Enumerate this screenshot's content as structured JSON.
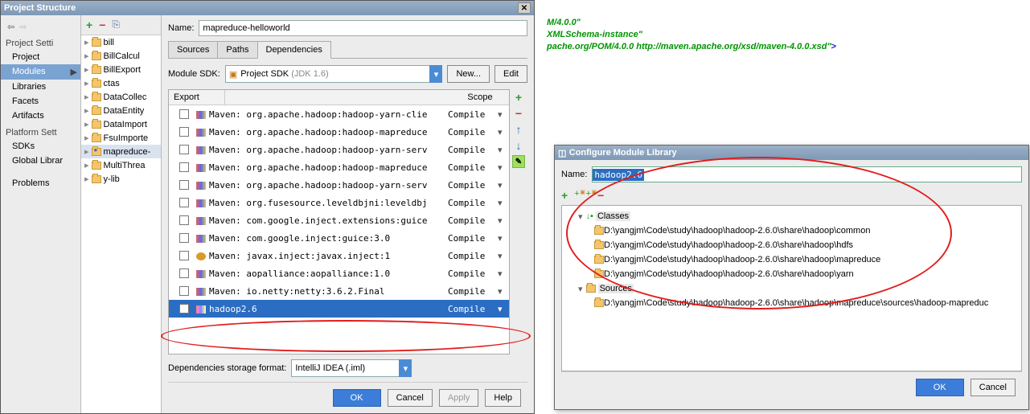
{
  "ps": {
    "title": "Project Structure",
    "sidebar": {
      "section1": "Project Setti",
      "items1": [
        "Project",
        "Modules",
        "Libraries",
        "Facets",
        "Artifacts"
      ],
      "section2": "Platform Sett",
      "items2": [
        "SDKs",
        "Global Librar"
      ],
      "section3": "Problems"
    },
    "modules": [
      "bill",
      "BillCalcul",
      "BillExport",
      "ctas",
      "DataCollec",
      "DataEntity",
      "DataImport",
      "FsuImporte",
      "mapreduce-",
      "MultiThrea",
      "y-lib"
    ],
    "name_label": "Name:",
    "name_value": "mapreduce-helloworld",
    "tabs": [
      "Sources",
      "Paths",
      "Dependencies"
    ],
    "sdk_label": "Module SDK:",
    "sdk_value": "Project SDK",
    "sdk_hint": "(JDK 1.6)",
    "btn_new": "New...",
    "btn_edit": "Edit",
    "head_export": "Export",
    "head_scope": "Scope",
    "deps": [
      {
        "label": "Maven: org.apache.hadoop:hadoop-yarn-clie",
        "scope": "Compile",
        "drop": true
      },
      {
        "label": "Maven: org.apache.hadoop:hadoop-mapreduce",
        "scope": "Compile",
        "drop": true
      },
      {
        "label": "Maven: org.apache.hadoop:hadoop-yarn-serv",
        "scope": "Compile",
        "drop": true
      },
      {
        "label": "Maven: org.apache.hadoop:hadoop-mapreduce",
        "scope": "Compile",
        "drop": true
      },
      {
        "label": "Maven: org.apache.hadoop:hadoop-yarn-serv",
        "scope": "Compile",
        "drop": true
      },
      {
        "label": "Maven: org.fusesource.leveldbjni:leveldbj",
        "scope": "Compile",
        "drop": true
      },
      {
        "label": "Maven: com.google.inject.extensions:guice",
        "scope": "Compile",
        "drop": true
      },
      {
        "label": "Maven: com.google.inject:guice:3.0",
        "scope": "Compile",
        "drop": true
      },
      {
        "label": "Maven: javax.inject:javax.inject:1",
        "scope": "Compile",
        "drop": true,
        "jar": true
      },
      {
        "label": "Maven: aopalliance:aopalliance:1.0",
        "scope": "Compile",
        "drop": true
      },
      {
        "label": "Maven: io.netty:netty:3.6.2.Final",
        "scope": "Compile",
        "drop": true
      },
      {
        "label": "hadoop2.6",
        "scope": "Compile",
        "drop": true,
        "sel": true
      }
    ],
    "storage_label": "Dependencies storage format:",
    "storage_value": "IntelliJ IDEA (.iml)",
    "ok": "OK",
    "cancel": "Cancel",
    "apply": "Apply",
    "help": "Help"
  },
  "bg": {
    "l1a": "M/4.0.0\"",
    "l2": "XMLSchema-instance\"",
    "l3a": "pache.org/POM/4.0.0 http://maven.apache.org/xsd/maven-4.0.0.xsd\"",
    "l3b": ">"
  },
  "cml": {
    "title": "Configure Module Library",
    "name_label": "Name:",
    "name_value": "hadoop2.6",
    "cat_classes": "Classes",
    "cat_sources": "Sources",
    "classes": [
      "D:\\yangjm\\Code\\study\\hadoop\\hadoop-2.6.0\\share\\hadoop\\common",
      "D:\\yangjm\\Code\\study\\hadoop\\hadoop-2.6.0\\share\\hadoop\\hdfs",
      "D:\\yangjm\\Code\\study\\hadoop\\hadoop-2.6.0\\share\\hadoop\\mapreduce",
      "D:\\yangjm\\Code\\study\\hadoop\\hadoop-2.6.0\\share\\hadoop\\yarn"
    ],
    "sources": [
      "D:\\yangjm\\Code\\study\\hadoop\\hadoop-2.6.0\\share\\hadoop\\mapreduce\\sources\\hadoop-mapreduc"
    ],
    "ok": "OK",
    "cancel": "Cancel"
  }
}
